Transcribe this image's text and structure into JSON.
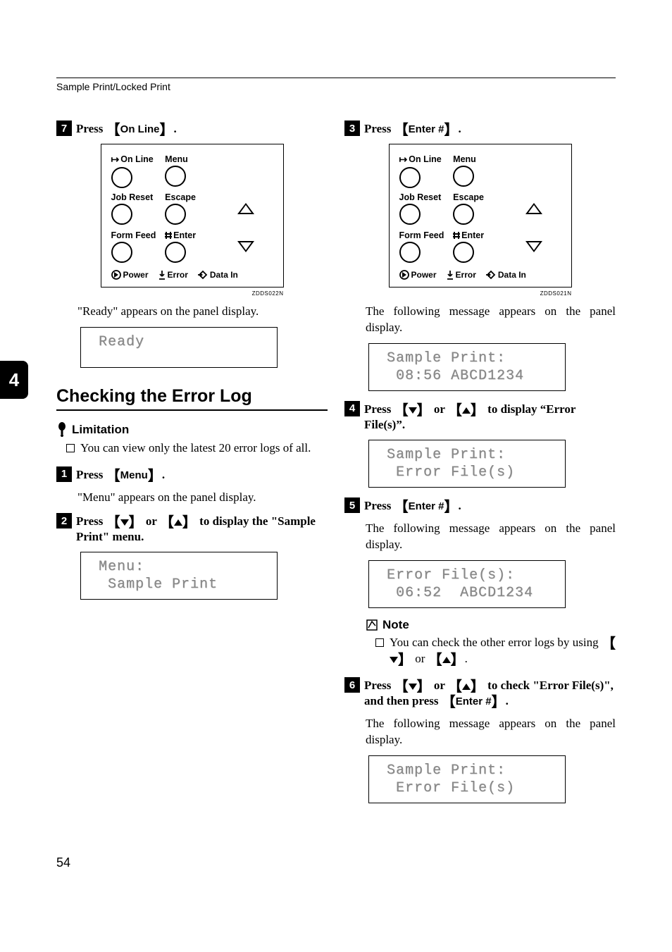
{
  "header": "Sample Print/Locked Print",
  "side_tab": "4",
  "page_number": "54",
  "panel": {
    "labels": {
      "online": "On Line",
      "menu": "Menu",
      "jobreset": "Job Reset",
      "escape": "Escape",
      "formfeed": "Form Feed",
      "enter": "Enter",
      "power": "Power",
      "error": "Error",
      "datain": "Data In"
    },
    "caption_left": "ZDDS022N",
    "caption_right": "ZDDS021N"
  },
  "left": {
    "step7": {
      "num": "7",
      "prefix": "Press ",
      "key": "On Line",
      "suffix": "."
    },
    "ready_text": "\"Ready\" appears on the panel display.",
    "lcd_ready": " Ready",
    "section_title": "Checking the Error Log",
    "limitation_label": "Limitation",
    "limitation_item": "You can view only the latest 20 error logs of all.",
    "step1": {
      "num": "1",
      "prefix": "Press ",
      "key": "Menu",
      "suffix": "."
    },
    "menu_text": "\"Menu\" appears on the panel display.",
    "step2": {
      "num": "2",
      "text_a": "Press ",
      "text_b": " or ",
      "text_c": " to display the \"Sample Print\" menu."
    },
    "lcd_menu": " Menu:\n  Sample Print"
  },
  "right": {
    "step3": {
      "num": "3",
      "prefix": "Press ",
      "key": "Enter #",
      "suffix": "."
    },
    "msg1": "The following message appears on the panel display.",
    "lcd1": " Sample Print:\n  08:56 ABCD1234",
    "step4": {
      "num": "4",
      "text_a": "Press ",
      "text_b": " or ",
      "text_c": " to display “Error File(s)”."
    },
    "lcd2": " Sample Print:\n  Error File(s)",
    "step5": {
      "num": "5",
      "prefix": "Press ",
      "key": "Enter #",
      "suffix": "."
    },
    "msg2": "The following message appears on the panel display.",
    "lcd3": " Error File(s):\n  06:52  ABCD1234",
    "note_label": "Note",
    "note_item_a": "You can check the other error logs by using ",
    "note_item_b": " or ",
    "note_item_c": ".",
    "step6": {
      "num": "6",
      "text_a": "Press ",
      "text_b": " or ",
      "text_c": " to check \"Error File(s)\", and then press ",
      "key": "Enter #",
      "text_d": "."
    },
    "msg3": "The following message appears on the panel display.",
    "lcd4": " Sample Print:\n  Error File(s)"
  }
}
